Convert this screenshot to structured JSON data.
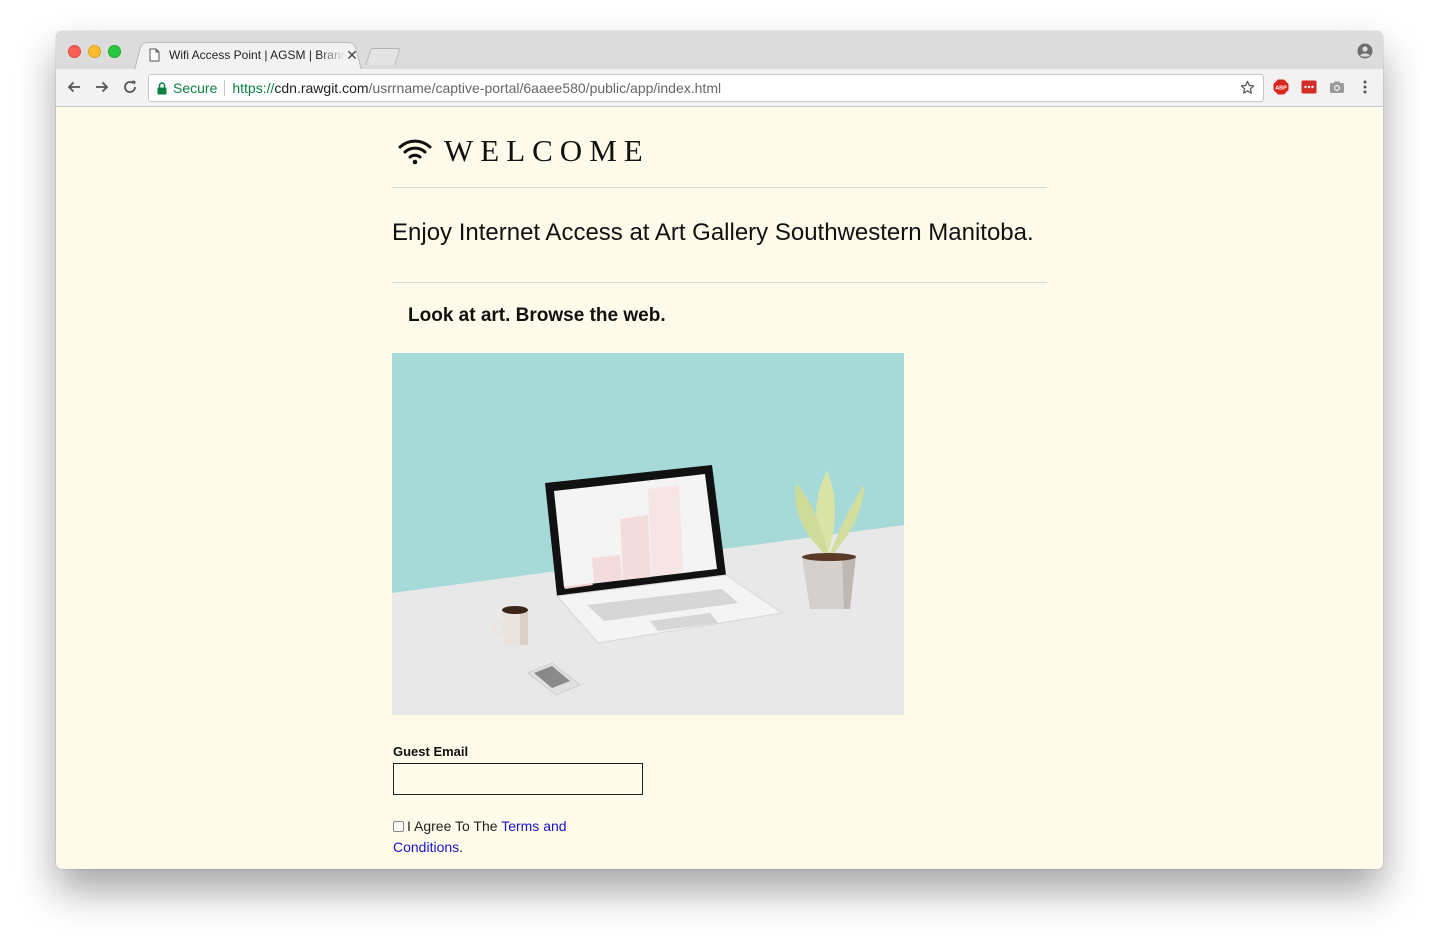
{
  "browser": {
    "tab_title": "Wifi Access Point | AGSM | Brandon",
    "tab_close": "✕",
    "secure_label": "Secure",
    "url_scheme": "https://",
    "url_host": "cdn.rawgit.com",
    "url_path": "/usrrname/captive-portal/6aaee580/public/app/index.html",
    "icons": {
      "back": "arrow-left-icon",
      "forward": "arrow-right-icon",
      "reload": "reload-icon",
      "lock": "lock-icon",
      "star": "star-icon",
      "profile": "profile-icon",
      "extensions": [
        "adblock-plus-icon",
        "lastpass-icon",
        "camera-icon",
        "kebab-menu-icon"
      ]
    }
  },
  "page": {
    "welcome_title": "WELCOME",
    "intro": "Enjoy Internet Access at Art Gallery Southwestern Manitoba.",
    "tagline": "Look at art. Browse the web.",
    "email_label": "Guest Email",
    "email_value": "",
    "agree_text": "I Agree To The ",
    "terms_link": "Terms and Conditions",
    "agree_suffix": "."
  },
  "colors": {
    "page_background": "#fefbea",
    "link": "#1a12c9",
    "illustration_sky": "#a6dad9",
    "illustration_desk": "#e8e8e8",
    "secure_green": "#0b8043"
  }
}
